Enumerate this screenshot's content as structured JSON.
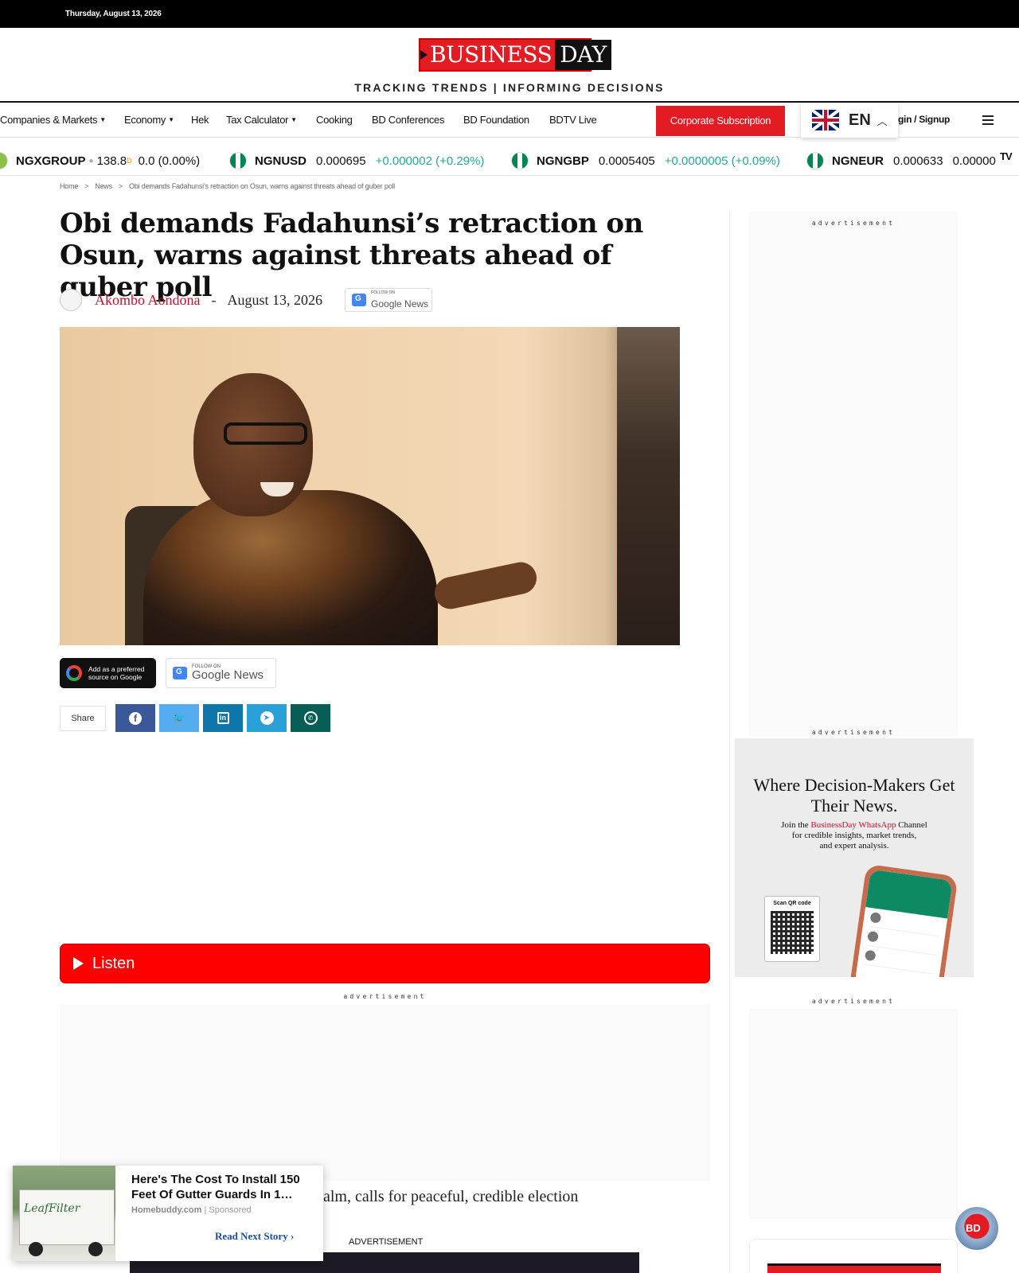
{
  "topbar": {
    "date": "Thursday, August 13, 2026"
  },
  "brand": {
    "logo_left": "BUSINESS",
    "logo_right": "DAY",
    "tagline": "TRACKING TRENDS   |   INFORMING DECISIONS",
    "accent": "#e31b23"
  },
  "nav": {
    "items": [
      "Companies & Markets",
      "Economy",
      "Hek",
      "Tax Calculator",
      "Cooking",
      "BD Conferences",
      "BD Foundation",
      "BDTV Live"
    ],
    "corporate_label": "Corporate Subscription",
    "language": "EN",
    "login": "gin / Signup"
  },
  "ticker": [
    {
      "symbol": "NGXGROUP",
      "price": "138.8",
      "superscript": "D",
      "change": "0.0 (0.00%)"
    },
    {
      "symbol": "NGNUSD",
      "price": "0.000695",
      "change": "+0.000002 (+0.29%)"
    },
    {
      "symbol": "NGNGBP",
      "price": "0.0005405",
      "change": "+0.0000005 (+0.09%)"
    },
    {
      "symbol": "NGNEUR",
      "price": "0.000633",
      "change": "0.00000"
    }
  ],
  "ticker_logo": "TV",
  "breadcrumb": {
    "home": "Home",
    "section": "News",
    "current": "Obi demands Fadahunsi’s retraction on Osun, warns against threats ahead of guber poll"
  },
  "article": {
    "title": "Obi demands Fadahunsi’s retraction on Osun, warns against threats ahead of guber poll",
    "author": "Akombo Aondona",
    "separator": "-",
    "date": "August 13, 2026",
    "related_snippet": "alm, calls for peaceful, credible election"
  },
  "badges": {
    "google_news_small": "FOLLOW ON",
    "google_news_brand": "Google News",
    "preferred_line1": "Add as a preferred",
    "preferred_line2": "source on Google"
  },
  "share": {
    "label": "Share",
    "buttons": [
      {
        "network": "facebook",
        "icon": "facebook-icon",
        "glyph": "f",
        "color": "#3b5998"
      },
      {
        "network": "twitter",
        "icon": "twitter-icon",
        "glyph": "🐦",
        "color": "#55acee"
      },
      {
        "network": "linkedin",
        "icon": "linkedin-icon",
        "glyph": "in",
        "color": "#0e76a8"
      },
      {
        "network": "telegram",
        "icon": "telegram-icon",
        "glyph": "➤",
        "color": "#2aa0d8"
      },
      {
        "network": "whatsapp",
        "icon": "whatsapp-icon",
        "glyph": "✆",
        "color": "#075e54"
      }
    ]
  },
  "listen": {
    "label": "Listen"
  },
  "ads": {
    "label": "advertisement",
    "word": "ADVERTISEMENT"
  },
  "sponsored": {
    "headline": "Here's The Cost To Install 150 Feet Of Gutter Guards In 1…",
    "source": "Homebuddy.com",
    "tag": "Sponsored",
    "cta": "Read Next Story",
    "image_brand": "LeafFilter"
  },
  "whatsapp_ad": {
    "headline": "Where Decision-Makers Get Their News.",
    "line1_pre": "Join the ",
    "line1_red": "BusinessDay WhatsApp",
    "line1_post": " Channel",
    "line2": "for credible insights, market trends,",
    "line3": "and expert analysis.",
    "qr_label": "Scan QR code"
  },
  "chat_widget": {
    "label": "BD"
  }
}
